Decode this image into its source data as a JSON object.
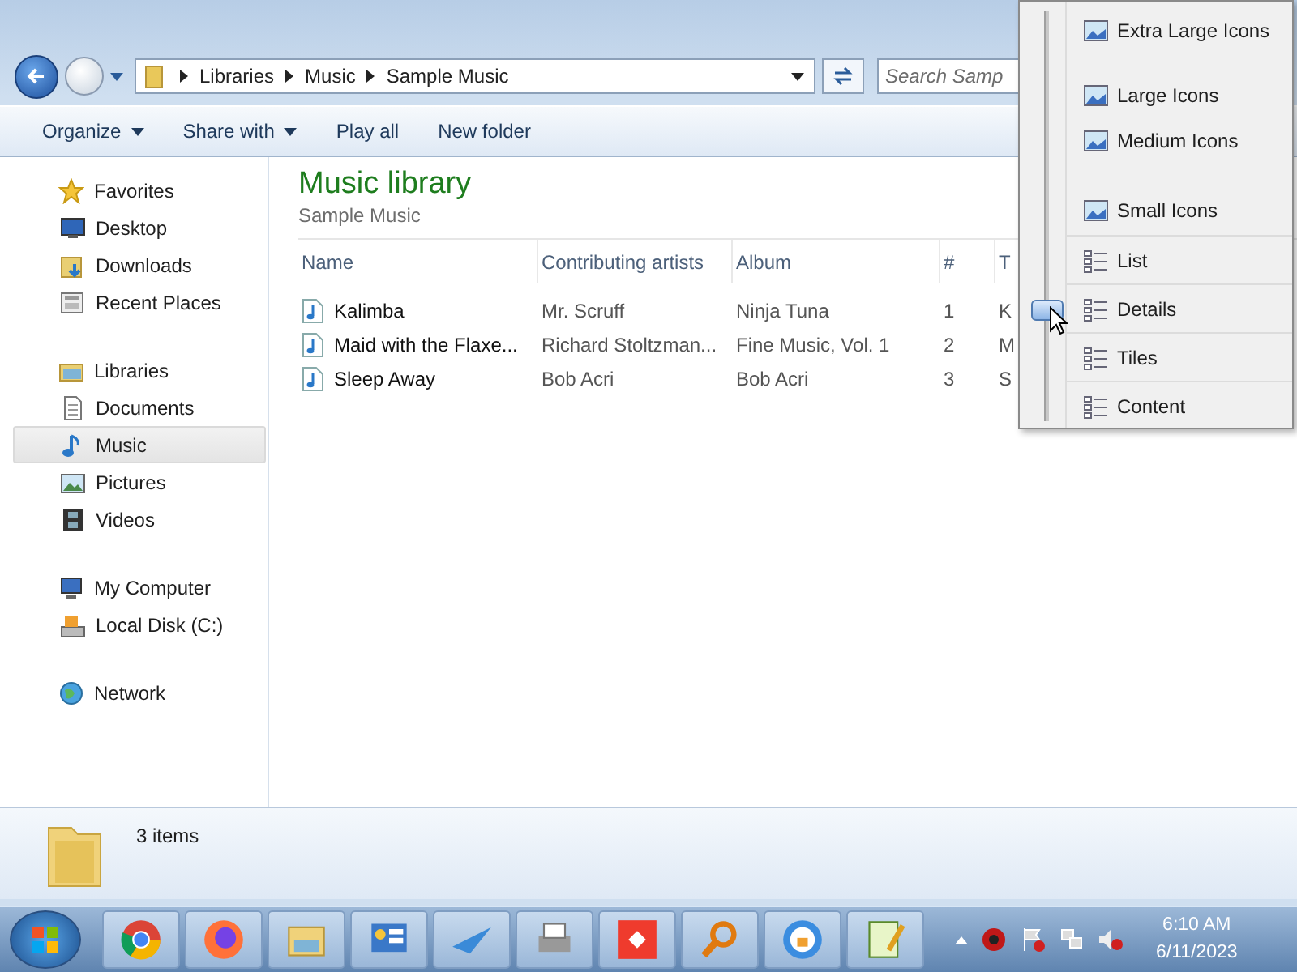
{
  "address_bar": {
    "breadcrumbs": [
      "Libraries",
      "Music",
      "Sample Music"
    ]
  },
  "search": {
    "placeholder": "Search Samp"
  },
  "toolbar": [
    {
      "label": "Organize",
      "dropdown": true
    },
    {
      "label": "Share with",
      "dropdown": true
    },
    {
      "label": "Play all",
      "dropdown": false
    },
    {
      "label": "New folder",
      "dropdown": false
    }
  ],
  "sidebar": {
    "groups": [
      {
        "label": "Favorites",
        "selected": false,
        "children": [
          {
            "label": "Desktop",
            "selected": false
          },
          {
            "label": "Downloads",
            "selected": false
          },
          {
            "label": "Recent Places",
            "selected": false
          }
        ]
      },
      {
        "label": "Libraries",
        "selected": false,
        "children": [
          {
            "label": "Documents",
            "selected": false
          },
          {
            "label": "Music",
            "selected": true
          },
          {
            "label": "Pictures",
            "selected": false
          },
          {
            "label": "Videos",
            "selected": false
          }
        ]
      },
      {
        "label": "My Computer",
        "selected": false,
        "children": [
          {
            "label": "Local Disk (C:)",
            "selected": false
          }
        ]
      },
      {
        "label": "Network",
        "selected": false
      }
    ]
  },
  "library": {
    "title": "Music library",
    "subtitle": "Sample Music"
  },
  "table": {
    "columns": [
      "Name",
      "Contributing artists",
      "Album",
      "#",
      "T"
    ],
    "rows": [
      [
        "Kalimba",
        "Mr. Scruff",
        "Ninja Tuna",
        "1",
        "K"
      ],
      [
        "Maid with the Flaxe...",
        "Richard Stoltzman...",
        "Fine Music, Vol. 1",
        "2",
        "M"
      ],
      [
        "Sleep Away",
        "Bob Acri",
        "Bob Acri",
        "3",
        "S"
      ]
    ]
  },
  "details_pane": {
    "count": "3 items"
  },
  "view_menu": {
    "level": 0.27,
    "items": [
      {
        "label": "Extra Large Icons",
        "kind": "size"
      },
      {
        "label": "Large Icons",
        "kind": "size"
      },
      {
        "label": "Medium Icons",
        "kind": "size"
      },
      {
        "label": "Small Icons",
        "kind": "size"
      },
      {
        "label": "List",
        "kind": "layout"
      },
      {
        "label": "Details",
        "kind": "layout"
      },
      {
        "label": "Tiles",
        "kind": "layout"
      },
      {
        "label": "Content",
        "kind": "layout"
      }
    ]
  },
  "taskbar": {
    "time": "6:10 AM",
    "date": "6/11/2023"
  }
}
